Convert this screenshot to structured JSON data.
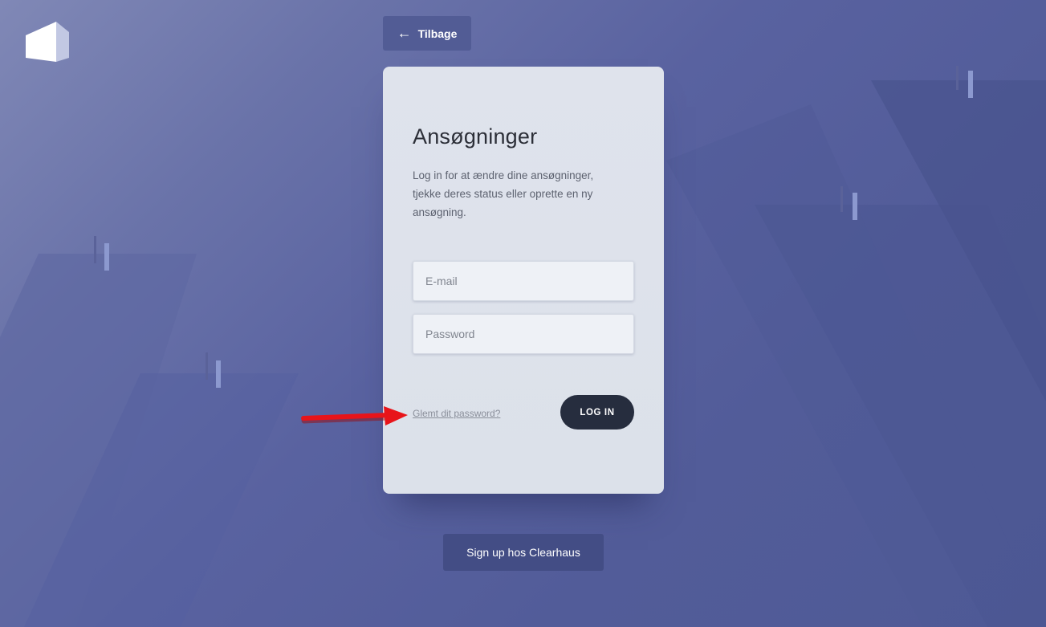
{
  "navigation": {
    "back_label": "Tilbage"
  },
  "login_card": {
    "title": "Ansøgninger",
    "description": "Log in for at ændre dine ansøgninger, tjekke deres status eller oprette en ny ansøgning.",
    "email_placeholder": "E-mail",
    "password_placeholder": "Password",
    "forgot_password_label": "Glemt dit password?",
    "login_button_label": "LOG IN"
  },
  "signup": {
    "label": "Sign up hos Clearhaus"
  },
  "icons": {
    "logo": "clearhaus-logo-icon",
    "back": "arrow-left-icon",
    "annotation": "red-arrow-annotation"
  },
  "colors": {
    "background": "#5962a0",
    "card": "#dfe3ec",
    "login_button": "#262d3e",
    "signup_button": "#434d85",
    "back_button": "#525c95",
    "annotation_arrow": "#e8141a"
  }
}
